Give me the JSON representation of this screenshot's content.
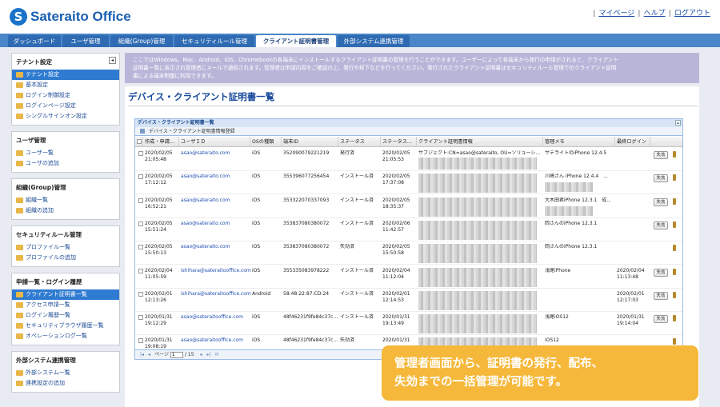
{
  "app": {
    "logo_letter": "S",
    "logo_text": "Sateraito Office",
    "top_links": [
      "マイページ",
      "ヘルプ",
      "ログアウト"
    ]
  },
  "tabs": [
    {
      "label": "ダッシュボード"
    },
    {
      "label": "ユーザ管理"
    },
    {
      "label": "組織(Group)管理"
    },
    {
      "label": "セキュリティルール管理"
    },
    {
      "label": "クライアント証明書管理",
      "active": true
    },
    {
      "label": "外部システム連携管理"
    }
  ],
  "sidebar": {
    "tenant": {
      "title": "テナント設定",
      "items": [
        "テナント設定",
        "基本設定",
        "ログイン制御設定",
        "ログインページ設定",
        "シングルサインオン設定"
      ]
    },
    "user": {
      "title": "ユーザ管理",
      "items": [
        "ユーザ一覧",
        "ユーザの追加"
      ]
    },
    "group": {
      "title": "組織(Group)管理",
      "items": [
        "組織一覧",
        "組織の追加"
      ]
    },
    "security": {
      "title": "セキュリティルール管理",
      "items": [
        "プロファイル一覧",
        "プロファイルの追加"
      ]
    },
    "request": {
      "title": "申請一覧・ログイン履歴",
      "items": [
        "クライアント証明書一覧",
        "アクセス申請一覧",
        "ログイン履歴一覧",
        "セキュリティブラウザ履歴一覧",
        "オペレーションログ一覧"
      ]
    },
    "external": {
      "title": "外部システム連携管理",
      "items": [
        "外部システム一覧",
        "連携設定の追加"
      ]
    }
  },
  "notice": {
    "line1": "ここではWindows、Mac、Android、iOS、Chromebookの各端末にインストールするクライアント証明書の管理を行うことができます。ユーザーによって各端末から発行の申請がされると、クライアント",
    "line2": "証明書一覧に表示され管理者にメールで通知されます。管理者は申請内容をご確認の上、発行や却下などを行ってください。発行されたクライアント証明書はセキュリティルール管理でのクライアント証明",
    "line3": "書による端末制御に利用できます。"
  },
  "panel": {
    "title": "デバイス・クライアント証明書一覧",
    "grid_title": "デバイス・クライアント証明書一覧",
    "toolbar_label": "デバイス・クライアント証明書情報登録"
  },
  "columns": [
    "作成・申請...",
    "ユーザＩＤ",
    "OSの種類",
    "端末ID",
    "ステータス",
    "ステータス...",
    "クライアント証明書情報",
    "管理メモ",
    "最終ログイン"
  ],
  "rows": [
    {
      "created1": "2020/02/05",
      "created2": "21:05:48",
      "user": "asao@sateraito.com",
      "os": "iOS",
      "device": "352090079221219",
      "status": "発行済",
      "st1": "2020/02/05",
      "st2": "21:05:53",
      "cert": "サブジェクト:CN=asao@sateraito, OU=ソリューシ...",
      "memo": "サテライトのiPhone 12.4.5",
      "memo2": "",
      "last1": "",
      "last2": "",
      "action": "失効"
    },
    {
      "created1": "2020/02/05",
      "created2": "17:12:12",
      "user": "asao@sateraito.com",
      "os": "iOS",
      "device": "355396077256454",
      "status": "インストール済",
      "st1": "2020/02/05",
      "st2": "17:37:08",
      "cert": "",
      "memo": "川崎さん iPhone 12.4.4　...",
      "memo2": "",
      "last1": "",
      "last2": "",
      "action": "失効"
    },
    {
      "created1": "2020/02/05",
      "created2": "16:52:21",
      "user": "asao@sateraito.com",
      "os": "iOS",
      "device": "353322070337093",
      "status": "インストール済",
      "st1": "2020/02/05",
      "st2": "18:35:37",
      "cert": "",
      "memo": "大木田君iPhone 12.3.1　成...",
      "memo2": "",
      "last1": "",
      "last2": "",
      "action": "失効"
    },
    {
      "created1": "2020/02/05",
      "created2": "15:51:24",
      "user": "asao@sateraito.com",
      "os": "iOS",
      "device": "353837080380072",
      "status": "インストール済",
      "st1": "2020/02/06",
      "st2": "11:42:57",
      "cert": "",
      "memo": "岡さんのiPhone 12.3.1",
      "memo2": "",
      "last1": "",
      "last2": "",
      "action": "失効"
    },
    {
      "created1": "2020/02/05",
      "created2": "15:50:13",
      "user": "asao@sateraito.com",
      "os": "iOS",
      "device": "353837080380072",
      "status": "失効済",
      "st1": "2020/02/05",
      "st2": "15:50:58",
      "cert": "",
      "memo": "岡さんのiPhone 12.3.1",
      "memo2": "",
      "last1": "",
      "last2": "",
      "action": ""
    },
    {
      "created1": "2020/02/04",
      "created2": "11:05:59",
      "user": "ishihara@sateraitooffice.com",
      "os": "iOS",
      "device": "355335083978222",
      "status": "インストール済",
      "st1": "2020/02/04",
      "st2": "11:12:04",
      "cert": "",
      "memo": "浅尾iPhone",
      "memo2": "",
      "last1": "2020/02/04",
      "last2": "11:13:48",
      "action": "失効"
    },
    {
      "created1": "2020/02/01",
      "created2": "12:13:26",
      "user": "ishihara@sateraitooffice.com",
      "os": "Android",
      "device": "58:48:22:87:CD:24",
      "status": "インストール済",
      "st1": "2020/02/01",
      "st2": "12:14:53",
      "cert": "",
      "memo": "",
      "memo2": "",
      "last1": "2020/02/01",
      "last2": "12:17:03",
      "action": "失効"
    },
    {
      "created1": "2020/01/31",
      "created2": "19:12:29",
      "user": "asao@sateraitooffice.com",
      "os": "iOS",
      "device": "48f46231f9fe84c37c...",
      "status": "インストール済",
      "st1": "2020/01/31",
      "st2": "19:13:49",
      "cert": "",
      "memo": "浅尾iOS12",
      "memo2": "",
      "last1": "2020/01/31",
      "last2": "19:14:04",
      "action": "失効"
    },
    {
      "created1": "2020/01/31",
      "created2": "19:08:19",
      "user": "asao@sateraitooffice.com",
      "os": "iOS",
      "device": "48f46231f9fe84c37c...",
      "status": "失効済",
      "st1": "2020/01/31",
      "st2": "",
      "cert": "",
      "memo": "iOS12",
      "memo2": "",
      "last1": "",
      "last2": "",
      "action": ""
    }
  ],
  "pager": {
    "label": "ページ",
    "current": "1",
    "total": "/ 15"
  },
  "callout": {
    "line1": "管理者画面から、証明書の発行、配布、",
    "line2": "失効までの一括管理が可能です。"
  }
}
